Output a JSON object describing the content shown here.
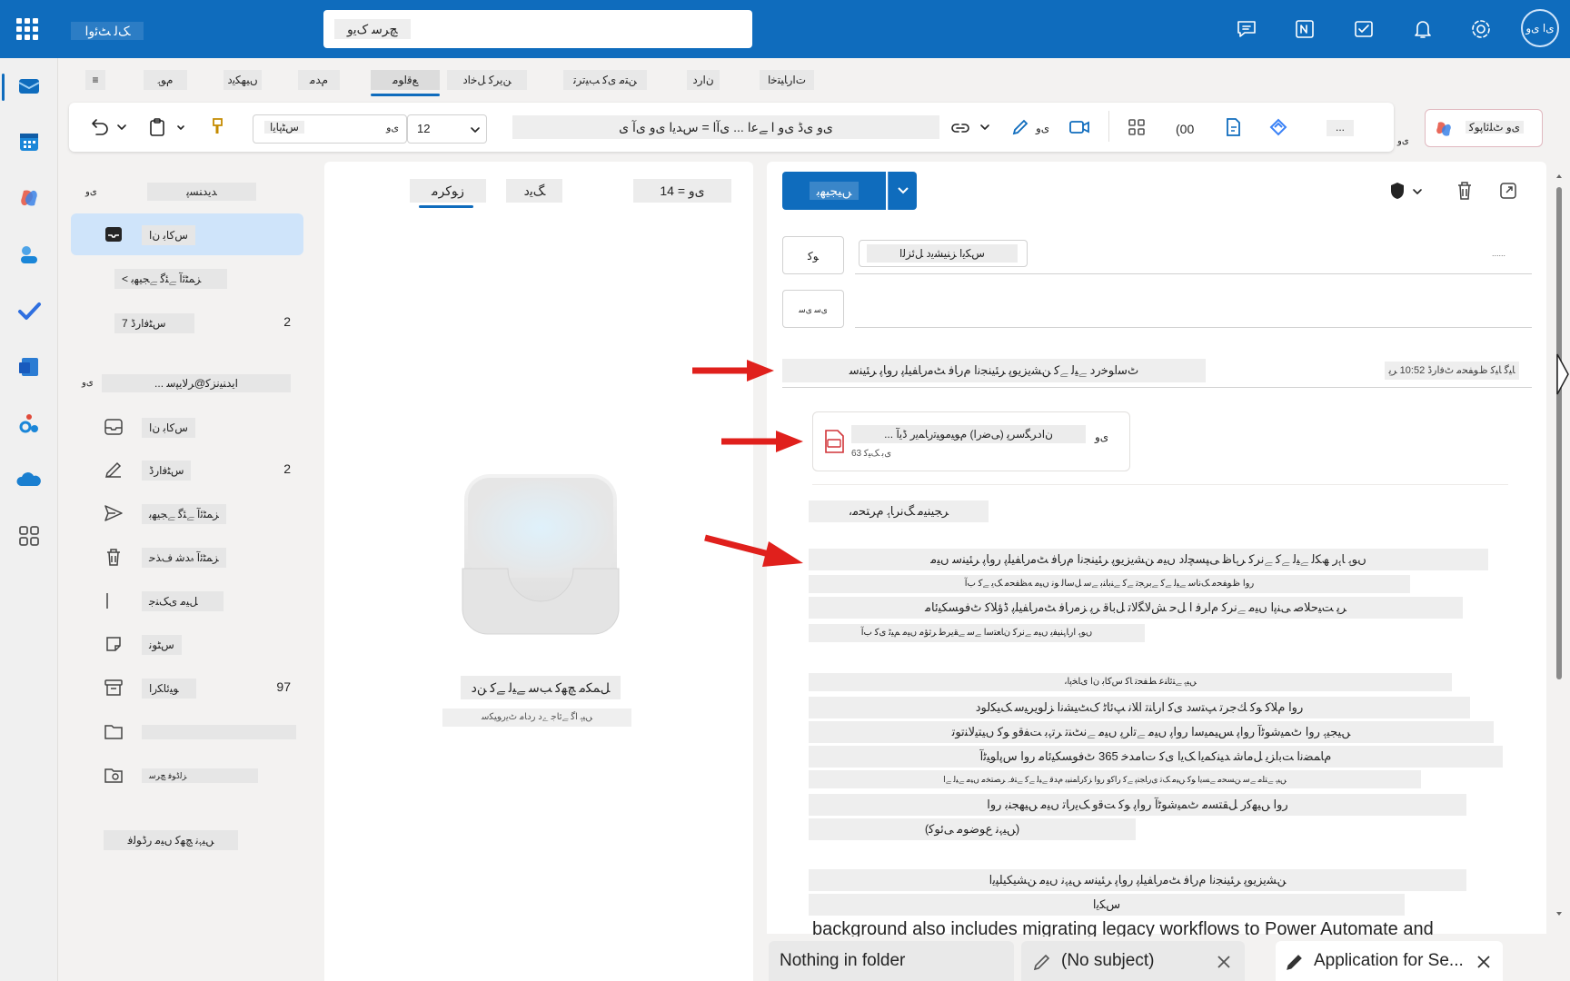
{
  "topbar": {
    "app_name": "ﮏﻟ ﭧﺋﻭﺍ",
    "search_placeholder": "ﭻﺮﺳ ﮎﯾﻭ",
    "avatar_initials": "ﯼﺍ ﯼﻭ"
  },
  "ribbon_tabs": [
    "≡",
    "ﻡﻮﮨ",
    "ﮞﯿﮭﮑﯾﺩ",
    "ﻡﺪﻣ",
    "ﻊﻗﺍﻮﻣ",
    "ﻦﯾﺮﮐ ﻞﺧﺍﺩ",
    "ﻦﺘﻣ ﯼﮐ ﺐﯿﺗﺮﺗ",
    "ﻥﺍﺭﺩ",
    "ﺕﺍﺭﺎﯿﺘﺧﺍ"
  ],
  "ribbon": {
    "font_name": "ﺱﭩﭘﺎﯾﺍ",
    "font_prefix": "ﯼﻭ",
    "font_size": "12",
    "format_text": "ﯼﻭ ﯼﮈ ﯼﻭ ﺍ ﮯﻋﺍ ... ﯼﺁﺍ = ﺱﺪﯾﺍ ﯼﻭ ﯼﺁ ﯼ",
    "mic_label": "ﯼﻭ",
    "zoom_label": "(00",
    "more_label": "...",
    "copilot_label": "ﯼﻭ ﭦﻠﺋﺎﭘﻮﮐ",
    "overflow_label": "ﯼﻭ"
  },
  "folders": {
    "favorites_header": "ﺪﯾﺪﻨﺴﭘ",
    "favorites_prefix": "ﯼﻭ",
    "items": [
      {
        "label": "ﺱﮐﺎﺑ ﻥﺍ",
        "count": "",
        "icon": "inbox-icon",
        "active": true
      },
      {
        "label": "< ﺰﻤﭩﺋﺁ ﮯﺌﮔ ﮯﺠﯿﮭﺑ",
        "count": "",
        "icon": "",
        "active": false
      },
      {
        "label": "ﺱﭩﻓﺍﺭﮈ 7",
        "count": "2",
        "icon": "",
        "active": false
      }
    ],
    "account_prefix": "ﯼﻭ",
    "account": "... ﺍﯾﺪﻨﯿﻧﺰﮐ@ﺮﻟﺎﯾﭙﺳ",
    "account_items": [
      {
        "label": "ﺱﮐﺎﺑ ﻥﺍ",
        "count": "",
        "icon": "inbox-icon"
      },
      {
        "label": "ﺱﭩﻓﺍﺭﮈ",
        "count": "2",
        "icon": "pencil-icon"
      },
      {
        "label": "ﺰﻤﭩﺋﺁ ﮯﺌﮔ ﮯﺠﯿﮭﺑ",
        "count": "",
        "icon": "send-icon"
      },
      {
        "label": "ﺰﻤﭩﺋﺁ ﮦﺪﺷ ﻑﺬﺣ",
        "count": "",
        "icon": "trash-icon"
      },
      {
        "label": "ﻞﯿﻣ ﯼﮏﻨﺟ",
        "count": "",
        "icon": "junk-icon"
      },
      {
        "label": "ﺱﭩﻮﻧ",
        "count": "",
        "icon": "note-icon"
      },
      {
        "label": "ﻮﯿﺋﺎﮑﺭﺍ",
        "count": "97",
        "icon": "archive-icon"
      },
      {
        "label": "",
        "count": "",
        "icon": "folder-icon"
      },
      {
        "label": "ﺰﻟﮈﻮﻓ ﭻﺮﺳ",
        "count": "",
        "icon": "search-folder-icon"
      }
    ],
    "footer": "ﮟﯿﮩﻧ ﭻﮭﮐ ﮞﯿﻣ ﺭﮈﻮﻟﻓ"
  },
  "list_pane": {
    "tab_focused": "ﺯﻮﮐﺮﻣ",
    "tab_other": "ﮓﯾﺩ",
    "filter_label": "ﯼﻭ = 14",
    "empty_title": "ﻞﻤﮑﻣ ﭻﮭﮐ ﺐﺳ ﮯﯿﻟ ﮯﮐ ﻦﺩ",
    "empty_sub": "ﮟﯿﮨ ﺍﮔ ﮯﺋﺎﺟ ﮮﺩ ﺭﺩﺎﻣ ﭦﯾﺭﻮﯿﮑﺳ"
  },
  "compose": {
    "send_label": "ﮟﯿﺠﯿﮭﺑ",
    "to_button": "ﻮﮐ",
    "cc_button": "ﯼﺳ ﯼﺳ",
    "recipient": "ﺱﮑﯾﺍ ﺰﻨﯿﺸﯾﺩ ﻞﺋﺰﻟﺍ",
    "cc_hint": "......",
    "subject": "ﭦﺳﺍﻮﺧﺭﺩ ﮯﯿﻟ ﮯﮐ ﻦﺸﯾﺰﯾﻮﭘ ﺮﺌﯿﻨﺠﻧﺍ ﻡﺭﺎﻓ ﭧﻣﺭﺎﻔﯿﻠﭘ ﺭﻭﺎﭘ ﺮﺌﯿﻨﺳ",
    "draft_saved": "ﺎﯿﮔ ﺎﯿﮐ ﻅﻮﻔﺤﻣ ﭦﻓﺍﺭﮈ 10:52 ﺮﭘ",
    "attachment_name": "... ﻥﺍﺩﺮﮕﺳﺮﭘ (ﯽﺿﺭﺍ) ﻡﻮﯿﻣﻮﯿﺗﺭﺎﻤﯾﺭ ﮈﯾﺁ",
    "attachment_size": "63 ﯼﺑ ﮏﯿﮐ",
    "attachment_more": "ﯼﻭ",
    "greeting": "،ﺮﺠﯿﻨﯿﻣ ﮓﻧﺮﺎﮨ ﻡﺮﺘﺤﻣ",
    "body": [
      "ﮞﻮﮨ ﺎﮨﺭ ﮫﮑﻟ ﮯﯿﻟ ﮯﮐ ﮯﻧﺮﮐ ﺮﮨﺎﻇ ﯽﭙﺴﭽﻟﺩ ﮞﯿﻣ ﻦﺸﯾﺰﯾﻮﭘ ﺮﺌﯿﻨﺠﻧﺍ ﻡﺭﺎﻓ ﭧﻣﺭﺎﻔﯿﻠﭘ ﺭﻭﺎﭘ ﺮﺌﯿﻨﺳ ﮞﯿﻣ",
      "ﺭﻭﺍ ﻅﻮﻔﺤﻣ ﮏﻧﺎﺳ ﮯﯿﻟ ﮯﮐ ﮯﺑﺮﺠﺗ ﮯﮐ ﮯﻨﺑﺎﻨﺑ ﮯﺳ ﻞﺳﺎﻟ ﻮﻧ ﮞﯿﻣ ﻪﻈﻔﺤﻣ ﮏﯾ ﮯﮐ ﺏﺁ",
      "ﺮﭘ ﺖﯿﺣﻼﺻ ﯽﻨﭘﺍ ﮞﯿﻣ ﮯﻧﺮﮐ ﻡﺍﺮﻓ ﺍ ﻞﺣ ﺶﻟﺎﮕﻟﺎﺗ ﻞﺑﺎﻗ ﺮﭘ ﺰﻣﺭﺎﻓ ﭧﻣﺭﺎﻔﯿﻠﭘ ﮈﺅﻼﮐ ﭦﻓﻮﺴﮑﯿﺋﺎﻣ",
      "ﮞﻮﮨ ﺍﺭﺎﮩﻨﯿﻔﯾ ﮞﯿﻣ ﮯﻧﺮﮐ ﻥﺎﻌﺘﺳﺍ ﮯﺳ ﮯﻘﯾﺮﻃ ﺮﺛﺆﻣ ﮞﯿﻣ ﻢﯿﭨ ﯼﮐ ﺏﺁ"
    ],
    "section": "،ﮟﯿﮨ ﮯﺘﺋﺎﻨﻋ ﻂﻔﺤﺗ ﺎﮐ ﺱﮐﺎﺑ ﻥﺍ ﯼﺎﺨﭘﺍ",
    "body2": [
      "ﺭﻭﺍ ﻡﻼﮐ ﻮﮐ ﻚﺟﺮﺗ ﭗﺘﺳﺩ ﯼﮐ ﺍﺭﺎﻨﺗ ﺍﻼﻧ ﭗﺋﺎﭨ ﮎﭧﯿﺸﻧﺍ ﺰﻟﻮﯾﺮﯿﺳ ﮏﻴﮑﻟﻮﺩ",
      "ﮟﯿﺠﯿﮨ ﺭﻭﺍ ﭦﻤﯿﺷﻮﭨﺁ ﺭﻭﺍﭘ ﺲﯿﻤﻴﺳﺍ ﺭﻭﺍﭘ ﮞﯿﻣ ﮯﺗﺍﺮﭘ ﮞﯿﻣ ﮯﻧﭧﻨﺗ ﺮﺗﮩﺑ ﺖﻔﻗﻭ ﻮﮐ ﮞﯿﺘﻴﻟﺎﻨﺗﻮﺗ",
      "ﻡﺎﻤﻀﻧﺍ ﺖﺑﺍﺰﯾ ﻞﻣﺎﺷ ﺪﯿﻨﮐﻤﯾﺍ ﮏﯾﺍ ﯼﮐ ﺕﺎﻣﺪﺧ 365 ﭦﻓﻮﺴﮑﯿﺋﺎﻣ ﺭﻭﺍ ﺱﭘﺍﻮﯿﭨﺁ",
      "ﮟﯿﮨ ﮯﺘﻠﻣ ﮯﺳ ﻦﺴﺤﻣ ﮯﺴﯾﺍ ﻮﮐ ﮟﯿﻣ ﮏﺗ ﯼﺭﺎﺠﻨﭘ ﮯﮐ ﺭﺍﮐﻭ ﺭﻭﺍ ﺰﮐﺭﺎﻤﻨﯿﺑ ﻡﺪﻗ ﮯﯿﻟ ﮯﮐ ﮯﺘﻓﮧ ﺮﺼﺘﺨﻣ ﮞﯿﻣ ﮯﯿﻟ ﮯﺍ",
      "ﺭﻭﺍ ﮟﯿﮭﮐﺭ ﻞﻘﺘﺴﻣ ﭦﻤﯿﺷﻮﭨﺁ ﺭﻭﺍﭘ ﻮﮐ ﺖﻗﻭ ﮏﯾﺭﺎﺗ ﮞﯿﻣ ﮟﯿﻬﺠﻨﺑ ﺭﻭﺍ",
      "(ﮟﯿﮩﻧ ﻉﻮﺿﻮﻣ ﯽﺋﻮﮐ)"
    ],
    "closing": "ﻦﺸﯾﺰﯾﻮﭘ ﺮﺌﯿﻨﺠﻧﺍ ﻡﺭﺎﻓ ﭧﻣﺭﺎﻔﯿﻠﭘ ﺭﻭﺎﭘ ﺮﺌﯿﻨﺳ ﮟﯿﮩﻧ ﮞﯿﻣ ﻦﺸﯿﮑﯿﻠﭙﯾﺍ",
    "closing2": "ﺱﮑﯾﺍ",
    "partial_line": "background also includes migrating legacy workflows to Power Automate and"
  },
  "bottom_tabs": [
    {
      "label": "Nothing in folder",
      "icon": ""
    },
    {
      "label": "(No subject)",
      "icon": "pencil-icon"
    },
    {
      "label": "Application for Se...",
      "icon": "pencil-icon"
    }
  ],
  "colors": {
    "brand": "#0f6cbd",
    "arrow": "#e0201c"
  }
}
